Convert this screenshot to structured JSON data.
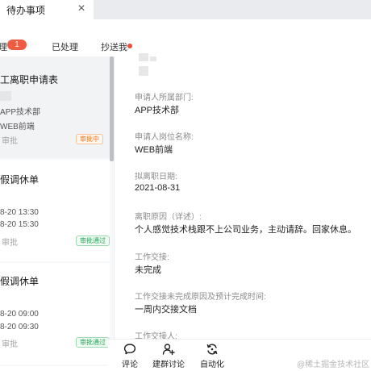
{
  "window_tab": {
    "title": "待办事项",
    "close_glyph": "×"
  },
  "subtabs": {
    "pending_partial": "理",
    "pending_count": "1",
    "processed": "已处理",
    "cc": "抄送我",
    "colors": {
      "badge": "#ee5c43",
      "dot": "#ee4e37"
    }
  },
  "list": [
    {
      "title": "工离职申请表",
      "line1": "APP技术部",
      "line2": "WEB前端",
      "meta": "审批",
      "status": "审批中",
      "status_color": "#ec7a2a"
    },
    {
      "title": "假调休单",
      "line1": "8-20 13:30",
      "line2": "8-20 15:30",
      "meta": "审批",
      "status": "审批通过",
      "status_color": "#2fa05a"
    },
    {
      "title": "假调休单",
      "line1": "8-20 09:00",
      "line2": "8-20 09:30",
      "meta": "审批",
      "status": "审批通过",
      "status_color": "#2fa05a"
    }
  ],
  "detail": {
    "fields": [
      {
        "label": "申请人所属部门:",
        "value": "APP技术部"
      },
      {
        "label": "申请人岗位名称:",
        "value": "WEB前端"
      },
      {
        "label": "拟离职日期:",
        "value": "2021-08-31"
      },
      {
        "label": "离职原因（详述）:",
        "value": "个人感觉技术栈跟不上公司业务，主动请辞。回家休息。"
      },
      {
        "label": "工作交接:",
        "value": "未完成"
      },
      {
        "label": "工作交接未完成原因及预计完成时间:",
        "value": "一周内交接文档"
      },
      {
        "label": "工作交接人:",
        "value": ""
      }
    ]
  },
  "actions": [
    {
      "label": "评论",
      "icon": "comment-icon"
    },
    {
      "label": "建群讨论",
      "icon": "add-group-icon"
    },
    {
      "label": "自动化",
      "icon": "refresh-icon"
    }
  ],
  "watermark": "@稀土掘金技术社区"
}
